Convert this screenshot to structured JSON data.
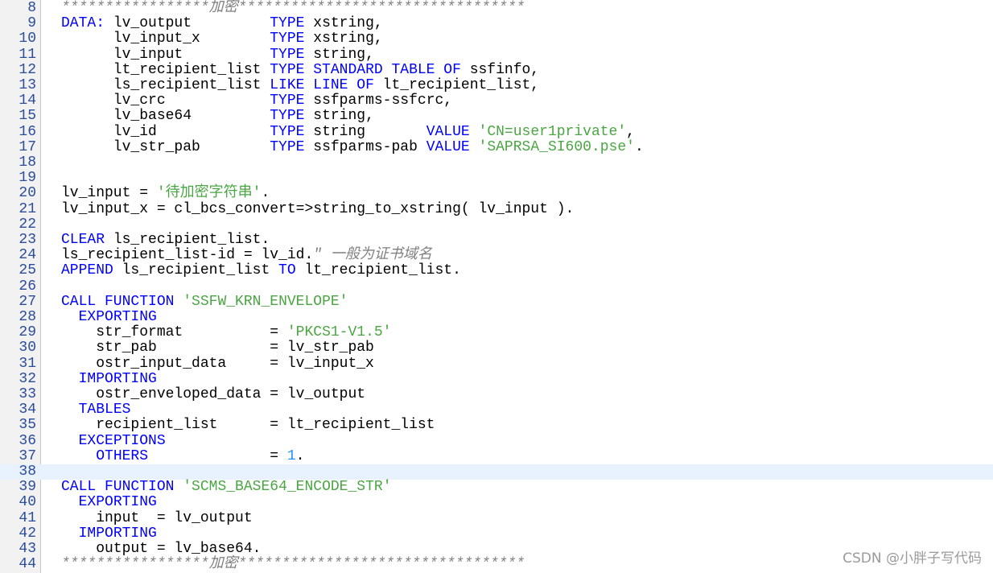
{
  "editor": {
    "lines": [
      {
        "no": "8",
        "tokens": [
          {
            "t": "*****************加密*********************************",
            "c": "cmt"
          }
        ]
      },
      {
        "no": "9",
        "tokens": [
          {
            "t": "DATA:",
            "c": "kw"
          },
          {
            "t": " lv_output         ",
            "c": ""
          },
          {
            "t": "TYPE",
            "c": "kw"
          },
          {
            "t": " xstring,",
            "c": ""
          }
        ]
      },
      {
        "no": "10",
        "tokens": [
          {
            "t": "      lv_input_x        ",
            "c": ""
          },
          {
            "t": "TYPE",
            "c": "kw"
          },
          {
            "t": " xstring,",
            "c": ""
          }
        ]
      },
      {
        "no": "11",
        "tokens": [
          {
            "t": "      lv_input          ",
            "c": ""
          },
          {
            "t": "TYPE",
            "c": "kw"
          },
          {
            "t": " string,",
            "c": ""
          }
        ]
      },
      {
        "no": "12",
        "tokens": [
          {
            "t": "      lt_recipient_list ",
            "c": ""
          },
          {
            "t": "TYPE STANDARD TABLE OF",
            "c": "kw"
          },
          {
            "t": " ssfinfo,",
            "c": ""
          }
        ]
      },
      {
        "no": "13",
        "tokens": [
          {
            "t": "      ls_recipient_list ",
            "c": ""
          },
          {
            "t": "LIKE LINE OF",
            "c": "kw"
          },
          {
            "t": " lt_recipient_list,",
            "c": ""
          }
        ]
      },
      {
        "no": "14",
        "tokens": [
          {
            "t": "      lv_crc            ",
            "c": ""
          },
          {
            "t": "TYPE",
            "c": "kw"
          },
          {
            "t": " ssfparms-ssfcrc,",
            "c": ""
          }
        ]
      },
      {
        "no": "15",
        "tokens": [
          {
            "t": "      lv_base64         ",
            "c": ""
          },
          {
            "t": "TYPE",
            "c": "kw"
          },
          {
            "t": " string,",
            "c": ""
          }
        ]
      },
      {
        "no": "16",
        "tokens": [
          {
            "t": "      lv_id             ",
            "c": ""
          },
          {
            "t": "TYPE",
            "c": "kw"
          },
          {
            "t": " string       ",
            "c": ""
          },
          {
            "t": "VALUE",
            "c": "kw"
          },
          {
            "t": " ",
            "c": ""
          },
          {
            "t": "'CN=user1private'",
            "c": "str"
          },
          {
            "t": ",",
            "c": ""
          }
        ]
      },
      {
        "no": "17",
        "tokens": [
          {
            "t": "      lv_str_pab        ",
            "c": ""
          },
          {
            "t": "TYPE",
            "c": "kw"
          },
          {
            "t": " ssfparms-pab ",
            "c": ""
          },
          {
            "t": "VALUE",
            "c": "kw"
          },
          {
            "t": " ",
            "c": ""
          },
          {
            "t": "'SAPRSA_SI600.pse'",
            "c": "str"
          },
          {
            "t": ".",
            "c": ""
          }
        ]
      },
      {
        "no": "18",
        "tokens": []
      },
      {
        "no": "19",
        "tokens": []
      },
      {
        "no": "20",
        "tokens": [
          {
            "t": "lv_input = ",
            "c": ""
          },
          {
            "t": "'待加密字符串'",
            "c": "str"
          },
          {
            "t": ".",
            "c": ""
          }
        ]
      },
      {
        "no": "21",
        "tokens": [
          {
            "t": "lv_input_x = cl_bcs_convert=>string_to_xstring( lv_input ).",
            "c": ""
          }
        ]
      },
      {
        "no": "22",
        "tokens": []
      },
      {
        "no": "23",
        "tokens": [
          {
            "t": "CLEAR",
            "c": "kw"
          },
          {
            "t": " ls_recipient_list.",
            "c": ""
          }
        ]
      },
      {
        "no": "24",
        "tokens": [
          {
            "t": "ls_recipient_list-id = lv_id.",
            "c": ""
          },
          {
            "t": "\" 一般为证书域名",
            "c": "cmt"
          }
        ]
      },
      {
        "no": "25",
        "tokens": [
          {
            "t": "APPEND",
            "c": "kw"
          },
          {
            "t": " ls_recipient_list ",
            "c": ""
          },
          {
            "t": "TO",
            "c": "kw"
          },
          {
            "t": " lt_recipient_list.",
            "c": ""
          }
        ]
      },
      {
        "no": "26",
        "tokens": []
      },
      {
        "no": "27",
        "tokens": [
          {
            "t": "CALL FUNCTION",
            "c": "kw"
          },
          {
            "t": " ",
            "c": ""
          },
          {
            "t": "'SSFW_KRN_ENVELOPE'",
            "c": "str"
          }
        ]
      },
      {
        "no": "28",
        "tokens": [
          {
            "t": "  ",
            "c": ""
          },
          {
            "t": "EXPORTING",
            "c": "kw"
          }
        ]
      },
      {
        "no": "29",
        "tokens": [
          {
            "t": "    str_format          = ",
            "c": ""
          },
          {
            "t": "'PKCS1-V1.5'",
            "c": "str"
          }
        ]
      },
      {
        "no": "30",
        "tokens": [
          {
            "t": "    str_pab             = lv_str_pab",
            "c": ""
          }
        ]
      },
      {
        "no": "31",
        "tokens": [
          {
            "t": "    ostr_input_data     = lv_input_x",
            "c": ""
          }
        ]
      },
      {
        "no": "32",
        "tokens": [
          {
            "t": "  ",
            "c": ""
          },
          {
            "t": "IMPORTING",
            "c": "kw"
          }
        ]
      },
      {
        "no": "33",
        "tokens": [
          {
            "t": "    ostr_enveloped_data = lv_output",
            "c": ""
          }
        ]
      },
      {
        "no": "34",
        "tokens": [
          {
            "t": "  ",
            "c": ""
          },
          {
            "t": "TABLES",
            "c": "kw"
          }
        ]
      },
      {
        "no": "35",
        "tokens": [
          {
            "t": "    recipient_list      = lt_recipient_list",
            "c": ""
          }
        ]
      },
      {
        "no": "36",
        "tokens": [
          {
            "t": "  ",
            "c": ""
          },
          {
            "t": "EXCEPTIONS",
            "c": "kw"
          }
        ]
      },
      {
        "no": "37",
        "tokens": [
          {
            "t": "    ",
            "c": ""
          },
          {
            "t": "OTHERS",
            "c": "kw"
          },
          {
            "t": "              = ",
            "c": ""
          },
          {
            "t": "1",
            "c": "num"
          },
          {
            "t": ".",
            "c": ""
          }
        ]
      },
      {
        "no": "38",
        "tokens": [],
        "current": true
      },
      {
        "no": "39",
        "tokens": [
          {
            "t": "CALL FUNCTION",
            "c": "kw"
          },
          {
            "t": " ",
            "c": ""
          },
          {
            "t": "'SCMS_BASE64_ENCODE_STR'",
            "c": "str"
          }
        ]
      },
      {
        "no": "40",
        "tokens": [
          {
            "t": "  ",
            "c": ""
          },
          {
            "t": "EXPORTING",
            "c": "kw"
          }
        ]
      },
      {
        "no": "41",
        "tokens": [
          {
            "t": "    input  = lv_output",
            "c": ""
          }
        ]
      },
      {
        "no": "42",
        "tokens": [
          {
            "t": "  ",
            "c": ""
          },
          {
            "t": "IMPORTING",
            "c": "kw"
          }
        ]
      },
      {
        "no": "43",
        "tokens": [
          {
            "t": "    output = lv_base64.",
            "c": ""
          }
        ]
      },
      {
        "no": "44",
        "tokens": [
          {
            "t": "*****************加密*********************************",
            "c": "cmt"
          }
        ]
      }
    ]
  },
  "watermark": "CSDN @小胖子写代码",
  "colors": {
    "keyword": "#0000ff",
    "string": "#4aa642",
    "comment": "#808080",
    "number": "#1e90ff",
    "line_number": "#2b4c9a",
    "current_line": "#e8f2fe"
  }
}
